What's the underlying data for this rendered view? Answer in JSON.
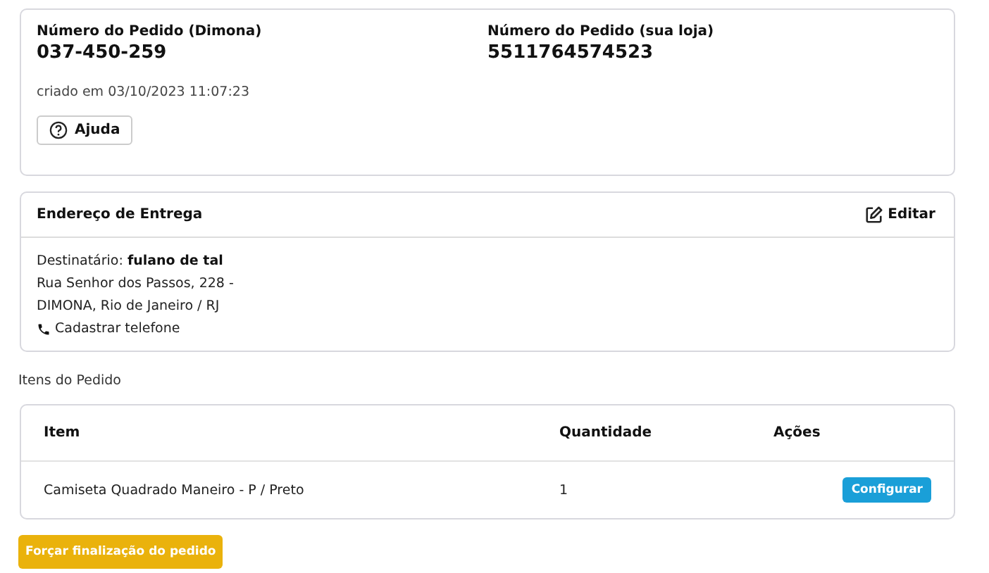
{
  "order": {
    "dimona_label": "Número do Pedido (Dimona)",
    "dimona_number": "037-450-259",
    "store_label": "Número do Pedido (sua loja)",
    "store_number": "5511764574523",
    "created": "criado em 03/10/2023 11:07:23",
    "help_button": "Ajuda"
  },
  "address": {
    "title": "Endereço de Entrega",
    "edit_button": "Editar",
    "recipient": "Destinatário: **fulano de tal**",
    "lines": [
      "Rua Senhor dos Passos, 228 -",
      "DIMONA, Rio de Janeiro / RJ"
    ],
    "phone_link": "Cadastrar telefone"
  },
  "items": {
    "title": "Itens do Pedido",
    "columns": [
      "Item",
      "Quantidade",
      "Ações"
    ],
    "rows": [
      {
        "item": "Camiseta Quadrado Maneiro - P / Preto",
        "quantity": "1",
        "action": "Configurar"
      }
    ]
  },
  "force_button": "Forçar finalização do pedido"
}
